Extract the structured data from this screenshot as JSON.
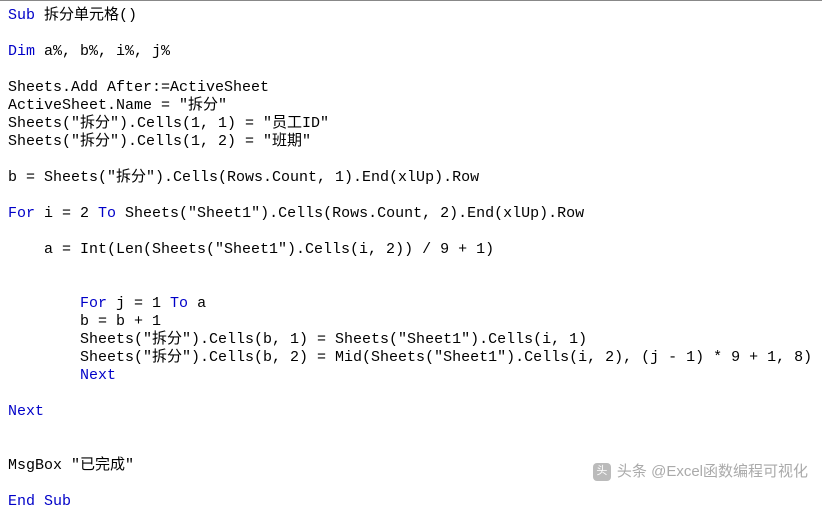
{
  "code": {
    "l01_kw": "Sub ",
    "l01_pl": "拆分单元格()",
    "l02_kw": "Dim ",
    "l02_pl": "a%, b%, i%, j%",
    "l03": "Sheets.Add After:=ActiveSheet",
    "l04": "ActiveSheet.Name = \"拆分\"",
    "l05": "Sheets(\"拆分\").Cells(1, 1) = \"员工ID\"",
    "l06": "Sheets(\"拆分\").Cells(1, 2) = \"班期\"",
    "l07": "b = Sheets(\"拆分\").Cells(Rows.Count, 1).End(xlUp).Row",
    "l08_kw": "For ",
    "l08_pl1": "i = 2 ",
    "l08_kw2": "To ",
    "l08_pl2": "Sheets(\"Sheet1\").Cells(Rows.Count, 2).End(xlUp).Row",
    "l09": "    a = Int(Len(Sheets(\"Sheet1\").Cells(i, 2)) / 9 + 1)",
    "l10_pad": "        ",
    "l10_kw": "For ",
    "l10_pl1": "j = 1 ",
    "l10_kw2": "To ",
    "l10_pl2": "a",
    "l11": "        b = b + 1",
    "l12": "        Sheets(\"拆分\").Cells(b, 1) = Sheets(\"Sheet1\").Cells(i, 1)",
    "l13": "        Sheets(\"拆分\").Cells(b, 2) = Mid(Sheets(\"Sheet1\").Cells(i, 2), (j - 1) * 9 + 1, 8)",
    "l14_pad": "        ",
    "l14_kw": "Next",
    "l15_kw": "Next",
    "l16": "MsgBox \"已完成\"",
    "l17_kw": "End Sub"
  },
  "watermark": {
    "icon": "头",
    "text": "头条 @Excel函数编程可视化"
  }
}
